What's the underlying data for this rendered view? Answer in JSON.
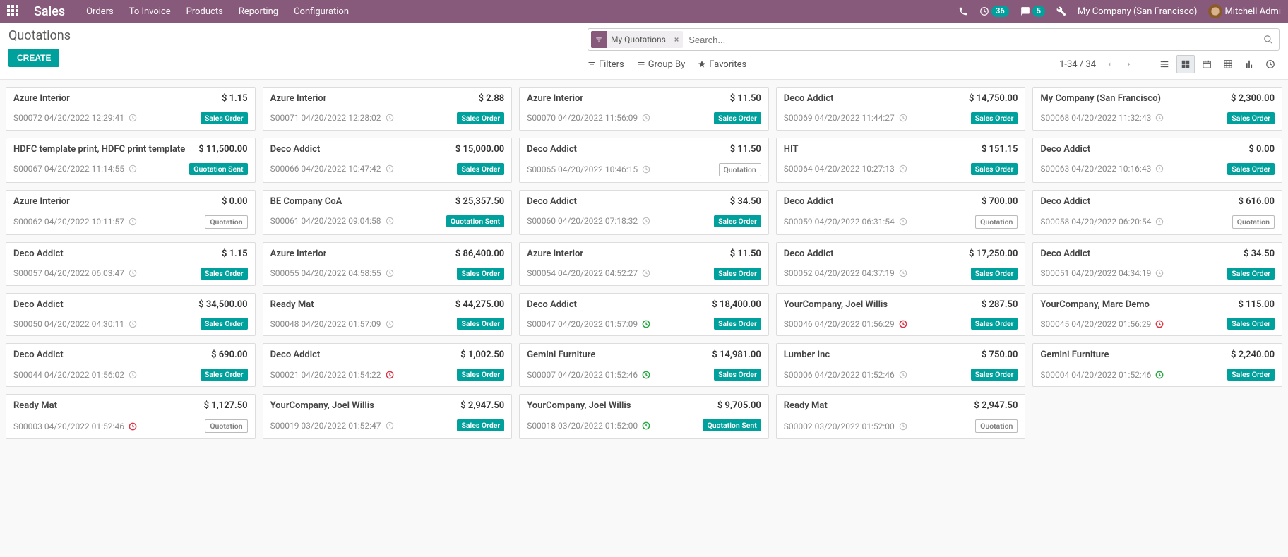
{
  "topbar": {
    "brand": "Sales",
    "menu": [
      "Orders",
      "To Invoice",
      "Products",
      "Reporting",
      "Configuration"
    ],
    "badgeA": "36",
    "badgeB": "5",
    "company": "My Company (San Francisco)",
    "user": "Mitchell Admi"
  },
  "breadcrumb": "Quotations",
  "buttons": {
    "create": "CREATE"
  },
  "search": {
    "facet_label": "My Quotations",
    "placeholder": "Search..."
  },
  "toolbar": {
    "filters": "Filters",
    "groupby": "Group By",
    "favorites": "Favorites",
    "pager": "1-34 / 34"
  },
  "status_labels": {
    "sales_order": "Sales Order",
    "quotation_sent": "Quotation Sent",
    "quotation": "Quotation"
  },
  "cards": [
    {
      "customer": "Azure Interior",
      "amount": "$ 1.15",
      "ref": "S00072 04/20/2022 12:29:41",
      "status": "sales_order",
      "activity": "gray"
    },
    {
      "customer": "Azure Interior",
      "amount": "$ 2.88",
      "ref": "S00071 04/20/2022 12:28:02",
      "status": "sales_order",
      "activity": "gray"
    },
    {
      "customer": "Azure Interior",
      "amount": "$ 11.50",
      "ref": "S00070 04/20/2022 11:56:09",
      "status": "sales_order",
      "activity": "gray"
    },
    {
      "customer": "Deco Addict",
      "amount": "$ 14,750.00",
      "ref": "S00069 04/20/2022 11:44:27",
      "status": "sales_order",
      "activity": "gray"
    },
    {
      "customer": "My Company (San Francisco)",
      "amount": "$ 2,300.00",
      "ref": "S00068 04/20/2022 11:32:43",
      "status": "sales_order",
      "activity": "gray"
    },
    {
      "customer": "HDFC template print, HDFC print template",
      "amount": "$ 11,500.00",
      "ref": "S00067 04/20/2022 11:14:55",
      "status": "quotation_sent",
      "activity": "gray"
    },
    {
      "customer": "Deco Addict",
      "amount": "$ 15,000.00",
      "ref": "S00066 04/20/2022 10:47:42",
      "status": "sales_order",
      "activity": "gray"
    },
    {
      "customer": "Deco Addict",
      "amount": "$ 11.50",
      "ref": "S00065 04/20/2022 10:46:15",
      "status": "quotation",
      "activity": "gray"
    },
    {
      "customer": "HIT",
      "amount": "$ 151.15",
      "ref": "S00064 04/20/2022 10:27:13",
      "status": "sales_order",
      "activity": "gray"
    },
    {
      "customer": "Deco Addict",
      "amount": "$ 0.00",
      "ref": "S00063 04/20/2022 10:16:43",
      "status": "sales_order",
      "activity": "gray"
    },
    {
      "customer": "Azure Interior",
      "amount": "$ 0.00",
      "ref": "S00062 04/20/2022 10:11:57",
      "status": "quotation",
      "activity": "gray"
    },
    {
      "customer": "BE Company CoA",
      "amount": "$ 25,357.50",
      "ref": "S00061 04/20/2022 09:04:58",
      "status": "quotation_sent",
      "activity": "gray"
    },
    {
      "customer": "Deco Addict",
      "amount": "$ 34.50",
      "ref": "S00060 04/20/2022 07:18:32",
      "status": "sales_order",
      "activity": "gray"
    },
    {
      "customer": "Deco Addict",
      "amount": "$ 700.00",
      "ref": "S00059 04/20/2022 06:31:54",
      "status": "quotation",
      "activity": "gray"
    },
    {
      "customer": "Deco Addict",
      "amount": "$ 616.00",
      "ref": "S00058 04/20/2022 06:20:54",
      "status": "quotation",
      "activity": "gray"
    },
    {
      "customer": "Deco Addict",
      "amount": "$ 1.15",
      "ref": "S00057 04/20/2022 06:03:47",
      "status": "sales_order",
      "activity": "gray"
    },
    {
      "customer": "Azure Interior",
      "amount": "$ 86,400.00",
      "ref": "S00055 04/20/2022 04:58:55",
      "status": "sales_order",
      "activity": "gray"
    },
    {
      "customer": "Azure Interior",
      "amount": "$ 11.50",
      "ref": "S00054 04/20/2022 04:52:27",
      "status": "sales_order",
      "activity": "gray"
    },
    {
      "customer": "Deco Addict",
      "amount": "$ 17,250.00",
      "ref": "S00052 04/20/2022 04:37:19",
      "status": "sales_order",
      "activity": "gray"
    },
    {
      "customer": "Deco Addict",
      "amount": "$ 34.50",
      "ref": "S00051 04/20/2022 04:34:19",
      "status": "sales_order",
      "activity": "gray"
    },
    {
      "customer": "Deco Addict",
      "amount": "$ 34,500.00",
      "ref": "S00050 04/20/2022 04:30:11",
      "status": "sales_order",
      "activity": "gray"
    },
    {
      "customer": "Ready Mat",
      "amount": "$ 44,275.00",
      "ref": "S00048 04/20/2022 01:57:09",
      "status": "sales_order",
      "activity": "gray"
    },
    {
      "customer": "Deco Addict",
      "amount": "$ 18,400.00",
      "ref": "S00047 04/20/2022 01:57:09",
      "status": "sales_order",
      "activity": "green"
    },
    {
      "customer": "YourCompany, Joel Willis",
      "amount": "$ 287.50",
      "ref": "S00046 04/20/2022 01:56:29",
      "status": "sales_order",
      "activity": "red"
    },
    {
      "customer": "YourCompany, Marc Demo",
      "amount": "$ 115.00",
      "ref": "S00045 04/20/2022 01:56:29",
      "status": "sales_order",
      "activity": "red"
    },
    {
      "customer": "Deco Addict",
      "amount": "$ 690.00",
      "ref": "S00044 04/20/2022 01:56:02",
      "status": "sales_order",
      "activity": "gray"
    },
    {
      "customer": "Deco Addict",
      "amount": "$ 1,002.50",
      "ref": "S00021 04/20/2022 01:54:22",
      "status": "sales_order",
      "activity": "red"
    },
    {
      "customer": "Gemini Furniture",
      "amount": "$ 14,981.00",
      "ref": "S00007 04/20/2022 01:52:46",
      "status": "sales_order",
      "activity": "green"
    },
    {
      "customer": "Lumber Inc",
      "amount": "$ 750.00",
      "ref": "S00006 04/20/2022 01:52:46",
      "status": "sales_order",
      "activity": "gray"
    },
    {
      "customer": "Gemini Furniture",
      "amount": "$ 2,240.00",
      "ref": "S00004 04/20/2022 01:52:46",
      "status": "sales_order",
      "activity": "green"
    },
    {
      "customer": "Ready Mat",
      "amount": "$ 1,127.50",
      "ref": "S00003 04/20/2022 01:52:46",
      "status": "quotation",
      "activity": "red"
    },
    {
      "customer": "YourCompany, Joel Willis",
      "amount": "$ 2,947.50",
      "ref": "S00019 03/20/2022 01:52:47",
      "status": "sales_order",
      "activity": "gray"
    },
    {
      "customer": "YourCompany, Joel Willis",
      "amount": "$ 9,705.00",
      "ref": "S00018 03/20/2022 01:52:00",
      "status": "quotation_sent",
      "activity": "green"
    },
    {
      "customer": "Ready Mat",
      "amount": "$ 2,947.50",
      "ref": "S00002 03/20/2022 01:52:00",
      "status": "quotation",
      "activity": "gray"
    }
  ]
}
